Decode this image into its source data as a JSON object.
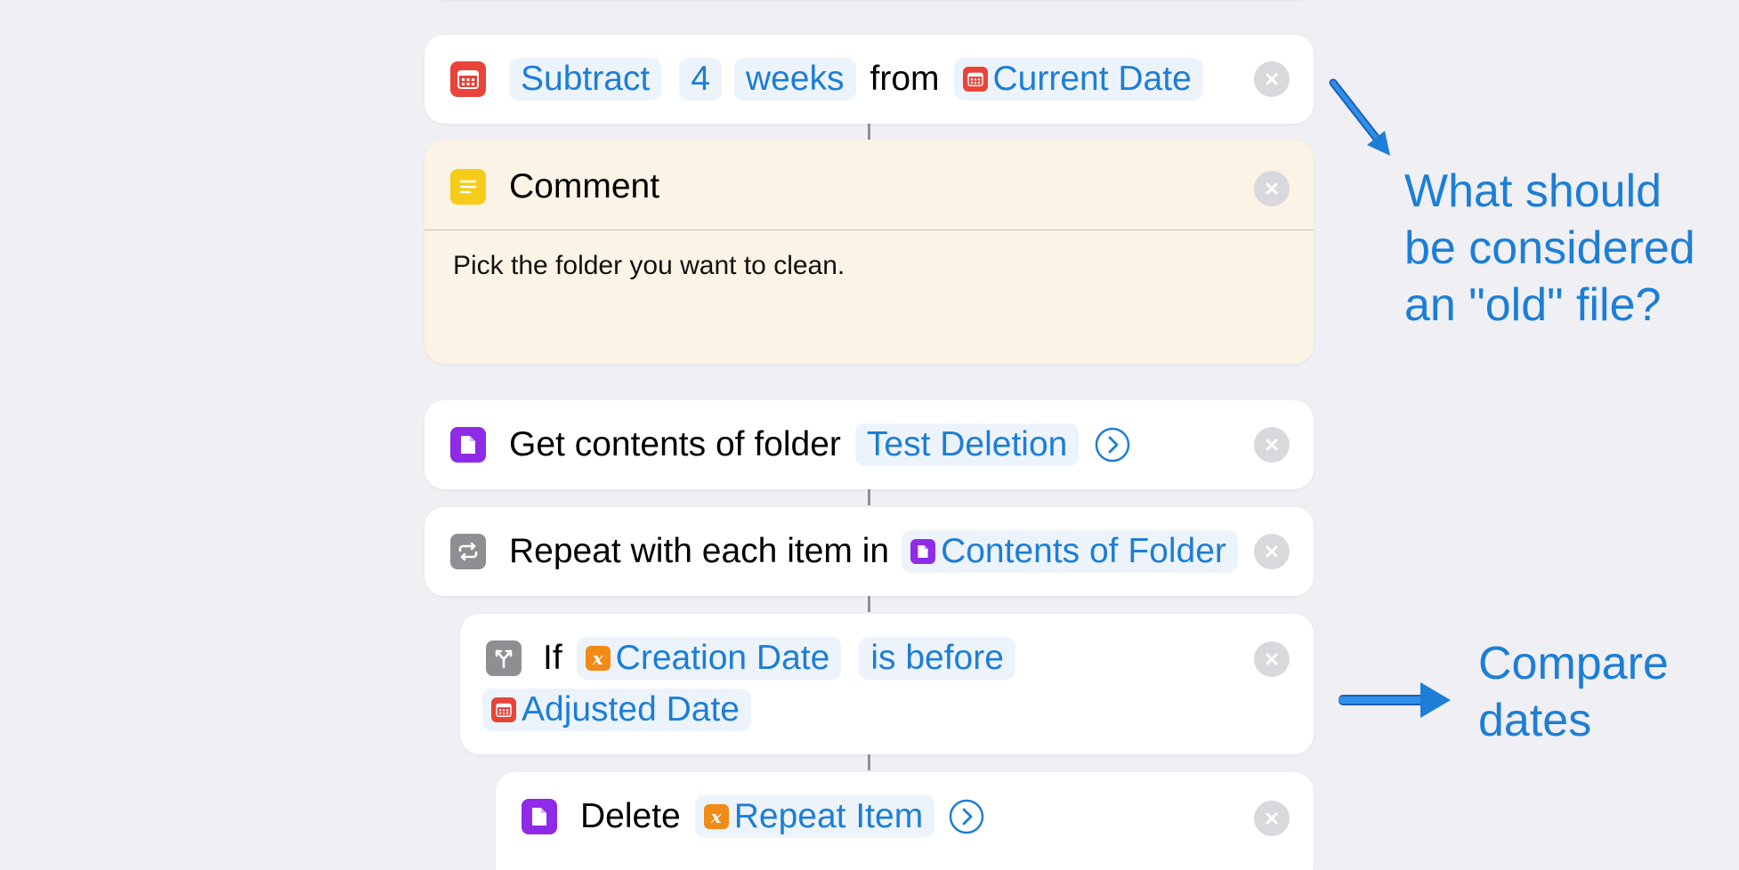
{
  "actions": {
    "subtract": {
      "verb": "Subtract",
      "amount": "4",
      "unit": "weeks",
      "from_label": "from",
      "target": "Current Date"
    },
    "comment": {
      "title": "Comment",
      "body": "Pick the folder you want to clean."
    },
    "get_contents": {
      "label": "Get contents of folder",
      "folder": "Test Deletion"
    },
    "repeat": {
      "label": "Repeat with each item in",
      "variable": "Contents of Folder"
    },
    "if": {
      "label": "If",
      "left": "Creation Date",
      "operator": "is before",
      "right": "Adjusted Date"
    },
    "delete": {
      "label": "Delete",
      "variable": "Repeat Item"
    }
  },
  "annotations": {
    "old_file_lines": [
      "What should",
      "be considered",
      "an \"old\" file?"
    ],
    "compare_lines": [
      "Compare",
      "dates"
    ]
  },
  "icons": {
    "calendar": "calendar-icon",
    "comment": "text-lines-icon",
    "document": "document-icon",
    "repeat": "repeat-icon",
    "if": "branch-icon",
    "variable": "variable-icon",
    "remove": "close-icon",
    "expand": "chevron-right-circle-icon",
    "arrow": "arrow-icon"
  },
  "colors": {
    "background": "#efeff4",
    "accent": "#1c7ed6",
    "token_bg": "#edf3fb",
    "calendar": "#e8443a",
    "comment": "#f6cc1a",
    "document": "#8f2be6",
    "control": "#8e8e93",
    "variable": "#f28a17",
    "comment_card": "#faf3e6"
  }
}
